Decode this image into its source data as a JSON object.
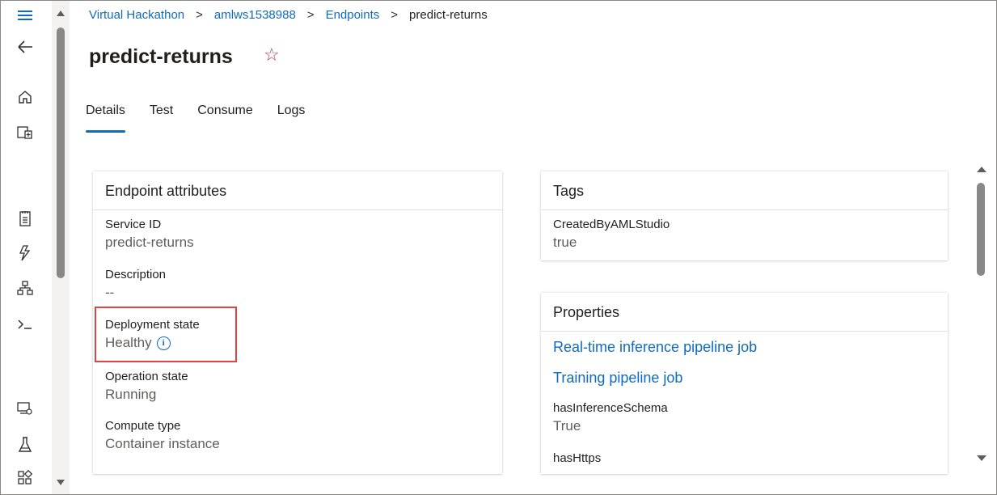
{
  "breadcrumb": {
    "items": [
      "Virtual Hackathon",
      "amlws1538988",
      "Endpoints"
    ],
    "current": "predict-returns",
    "separator": ">"
  },
  "page": {
    "title": "predict-returns",
    "favorite_icon": "star-icon"
  },
  "tabs": [
    {
      "label": "Details",
      "active": true
    },
    {
      "label": "Test",
      "active": false
    },
    {
      "label": "Consume",
      "active": false
    },
    {
      "label": "Logs",
      "active": false
    }
  ],
  "endpoint_attributes": {
    "header": "Endpoint attributes",
    "fields": [
      {
        "label": "Service ID",
        "value": "predict-returns"
      },
      {
        "label": "Description",
        "value": "--"
      },
      {
        "label": "Deployment state",
        "value": "Healthy"
      },
      {
        "label": "Operation state",
        "value": "Running"
      },
      {
        "label": "Compute type",
        "value": "Container instance"
      }
    ]
  },
  "tags": {
    "header": "Tags",
    "fields": [
      {
        "label": "CreatedByAMLStudio",
        "value": "true"
      }
    ]
  },
  "properties": {
    "header": "Properties",
    "links": [
      "Real-time inference pipeline job",
      "Training pipeline job"
    ],
    "fields": [
      {
        "label": "hasInferenceSchema",
        "value": "True"
      },
      {
        "label": "hasHttps",
        "value": ""
      }
    ]
  },
  "nav_icons": [
    "hamburger-menu-icon",
    "back-arrow-icon",
    "home-icon",
    "workspace-icon",
    "notebook-icon",
    "automl-icon",
    "pipeline-icon",
    "terminal-icon",
    "compute-icon",
    "experiment-icon",
    "endpoints-icon"
  ],
  "colors": {
    "accent": "#0f6cbd",
    "highlight": "#e04343",
    "star": "#c4314b"
  }
}
